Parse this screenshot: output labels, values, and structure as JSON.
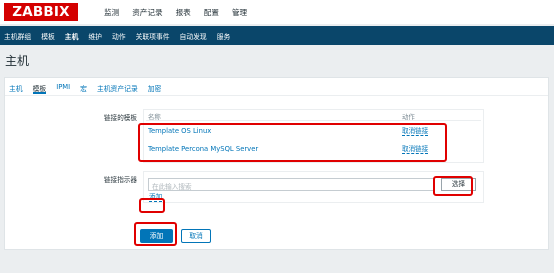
{
  "app": {
    "logo": "ZABBIX"
  },
  "main_menu": [
    "监测",
    "资产记录",
    "报表",
    "配置",
    "管理"
  ],
  "sub_menu": [
    "主机群组",
    "模板",
    "主机",
    "维护",
    "动作",
    "关联项事件",
    "自动发现",
    "服务"
  ],
  "page": {
    "title": "主机"
  },
  "tabs": [
    "主机",
    "模板",
    "IPMI",
    "宏",
    "主机资产记录",
    "加密"
  ],
  "linked_templates": {
    "label": "链接的模板",
    "col_name": "名称",
    "col_action": "动作",
    "rows": [
      {
        "name": "Template OS Linux",
        "action": "取消链接"
      },
      {
        "name": "Template Percona MySQL Server",
        "action": "取消链接"
      }
    ]
  },
  "link_indicator": {
    "label": "链接指示器",
    "placeholder": "在此输入搜索",
    "select_label": "选择",
    "add_link": "添加"
  },
  "buttons": {
    "add": "添加",
    "cancel": "取消"
  },
  "colors": {
    "brand": "#d40000",
    "subnav": "#0a466a",
    "link": "#0275b8",
    "highlight": "#e00000"
  }
}
